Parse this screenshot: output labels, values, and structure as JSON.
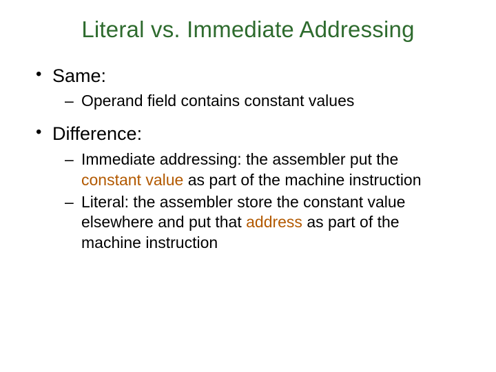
{
  "title": "Literal vs. Immediate Addressing",
  "bullets": [
    {
      "label": "Same:",
      "sub": [
        {
          "plain": "Operand field contains constant values"
        }
      ]
    },
    {
      "label": "Difference:",
      "sub": [
        {
          "pre": "Immediate addressing: the assembler put the ",
          "accent": "constant value",
          "post": " as part of the machine instruction"
        },
        {
          "pre": "Literal: the assembler store the constant value elsewhere and put that ",
          "accent": "address",
          "post": " as part of the machine instruction"
        }
      ]
    }
  ]
}
